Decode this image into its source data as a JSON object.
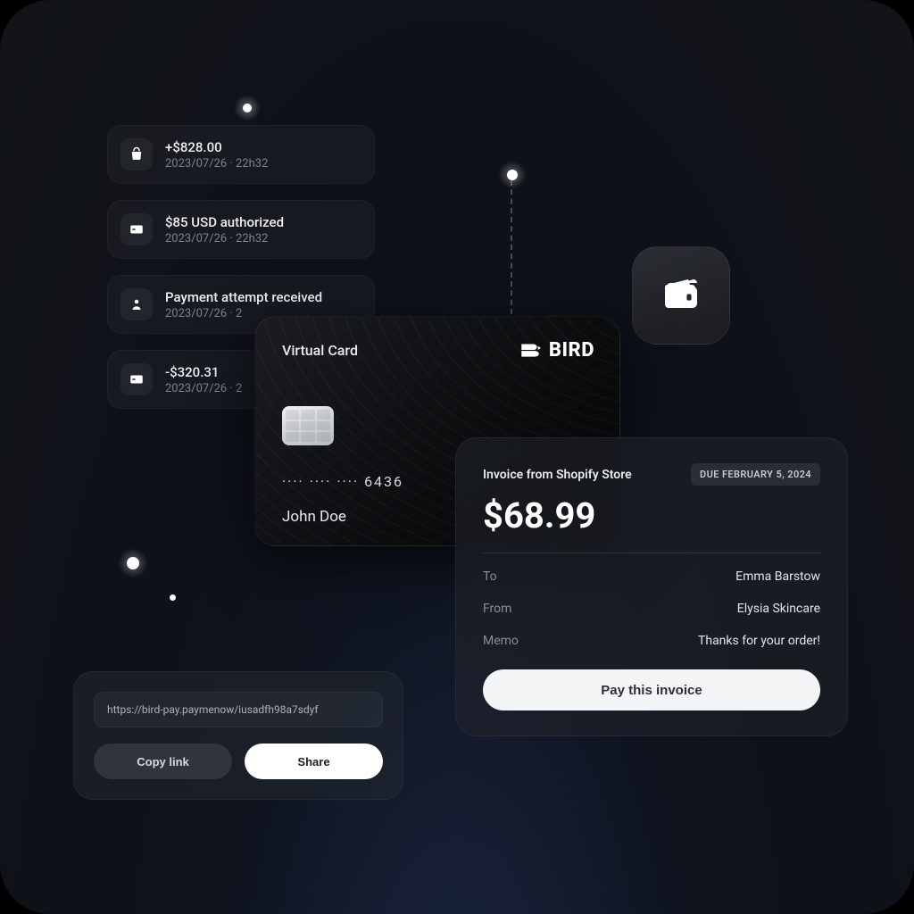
{
  "transactions": [
    {
      "title": "+$828.00",
      "sub": "2023/07/26 · 22h32"
    },
    {
      "title": "$85 USD authorized",
      "sub": "2023/07/26 · 22h32"
    },
    {
      "title": "Payment attempt received",
      "sub": "2023/07/26 · 2"
    },
    {
      "title": "-$320.31",
      "sub": "2023/07/26 · 2"
    }
  ],
  "card": {
    "label": "Virtual Card",
    "brand": "BIRD",
    "number": "···· ···· ···· 6436",
    "holder": "John Doe"
  },
  "invoice": {
    "title": "Invoice from Shopify Store",
    "due": "DUE FEBRUARY 5,  2024",
    "amount": "$68.99",
    "to_label": "To",
    "to_value": "Emma Barstow",
    "from_label": "From",
    "from_value": "Elysia Skincare",
    "memo_label": "Memo",
    "memo_value": "Thanks for your order!",
    "pay_button": "Pay this invoice"
  },
  "share": {
    "url": "https://bird-pay.paymenow/iusadfh98a7sdyf",
    "copy_label": "Copy link",
    "share_label": "Share"
  }
}
